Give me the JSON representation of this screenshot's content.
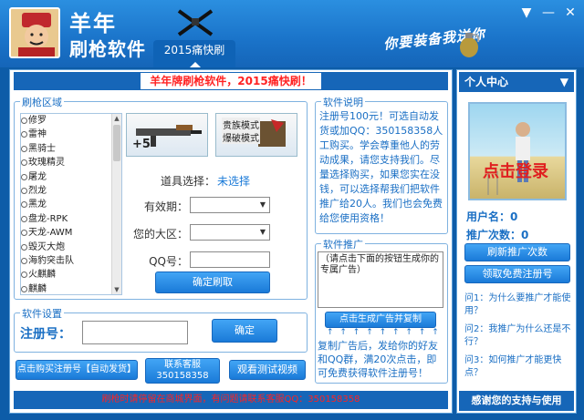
{
  "titlebar": {
    "title_line1": "羊年",
    "title_line2": "刷枪软件",
    "tab_label": "2015痛快刷",
    "slogan": "你要装备我送你",
    "menu_btn": "▼",
    "min_btn": "—",
    "close_btn": "✕"
  },
  "banner": {
    "text": "羊年牌刷枪软件，2015痛快刷！"
  },
  "weapon_area": {
    "title": "刷枪区域",
    "weapons": [
      "修罗",
      "雷神",
      "黑骑士",
      "玫瑰精灵",
      "屠龙",
      "烈龙",
      "黑龙",
      "盘龙-RPK",
      "天龙-AWM",
      "毁灭大炮",
      "海豹突击队",
      "火麒麟",
      "麒麟"
    ],
    "plus_label": "+5",
    "img2_line1": "贵族模式",
    "img2_line2": "爆破模式",
    "item_label": "道具选择：",
    "item_value": "未选择",
    "validity_label": "有效期：",
    "region_label": "您的大区：",
    "qq_label": "QQ号：",
    "confirm_btn": "确定刷取"
  },
  "soft_settings": {
    "title": "软件设置",
    "reg_label": "注册号：",
    "confirm_btn": "确定"
  },
  "soft_desc": {
    "title": "软件说明",
    "text": "注册号100元！可选自动发货或加QQ：350158358人工购买。学会尊重他人的劳动成果，请您支持我们。尽量选择购买，如果您实在没钱，可以选择帮我们把软件推广给20人。我们也会免费给您使用资格！"
  },
  "soft_promo": {
    "title": "软件推广",
    "textarea": "（请点击下面的按钮生成你的专属广告）",
    "gen_btn": "点击生成广告并复制",
    "arrows": "↑ ↑ ↑ ↑ ↑ ↑ ↑ ↑ ↑",
    "desc": "复制广告后，发给你的好友和QQ群，满20次点击，即可免费获得软件注册号！"
  },
  "bottom_buttons": {
    "buy": "点击购买注册号【自动发货】",
    "contact_line1": "联系客服",
    "contact_line2": "350158358",
    "video": "观看测试视频"
  },
  "footer": {
    "text": "刷枪时请停留在商城界面，有问题请联系客服QQ：350158358"
  },
  "sidebar": {
    "title": "个人中心",
    "login_text": "点击登录",
    "username_label": "用户名：0",
    "promo_count": "推广次数：0",
    "refresh_btn": "刷新推广次数",
    "free_btn": "领取免费注册号",
    "q1": "问1：为什么要推广才能使用？",
    "q2": "问2：我推广为什么还是不行？",
    "q3": "问3：如何推广才能更快点？",
    "footer": "感谢您的支持与使用"
  }
}
